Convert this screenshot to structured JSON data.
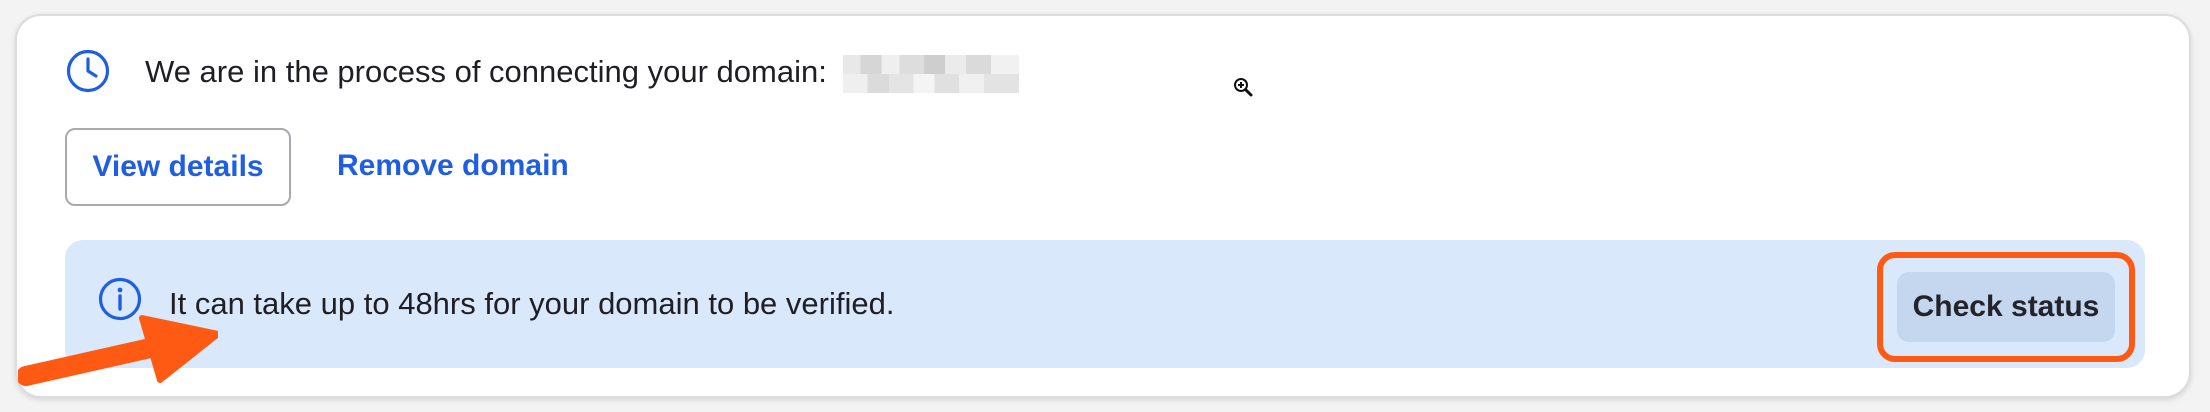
{
  "status": {
    "pending_message": "We are in the process of connecting your domain:",
    "icon": "clock-icon"
  },
  "actions": {
    "view_details_label": "View details",
    "remove_domain_label": "Remove domain"
  },
  "info_banner": {
    "message": "It can take up to 48hrs for your domain to be verified.",
    "icon": "info-icon",
    "check_status_label": "Check status"
  },
  "colors": {
    "link_blue": "#1f5ee0",
    "banner_bg": "#d9e8fb",
    "button_bg": "#c4d7ee",
    "annotation_orange": "#ff5a14"
  }
}
